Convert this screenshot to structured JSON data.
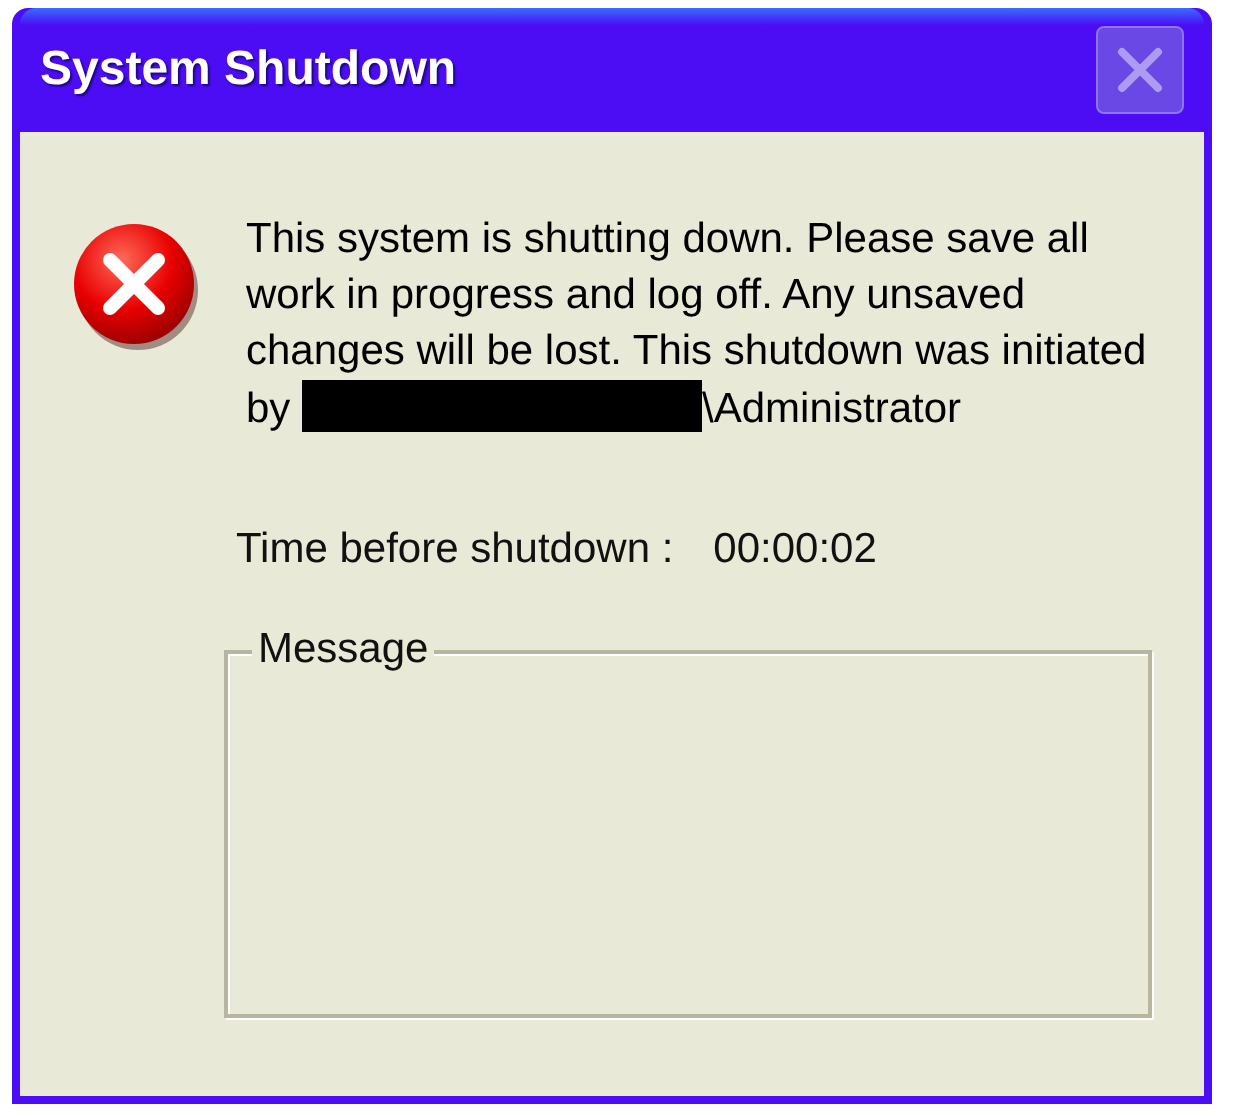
{
  "window": {
    "title": "System Shutdown",
    "close_disabled": true
  },
  "message": {
    "text": "This system is shutting down. Please save all work in progress and log off. Any unsaved changes will be lost. This shutdown was initiated by",
    "redacted": true,
    "after": "\\Administrator"
  },
  "countdown": {
    "label": "Time before shutdown :",
    "value": "00:00:02"
  },
  "message_group": {
    "label": "Message"
  }
}
